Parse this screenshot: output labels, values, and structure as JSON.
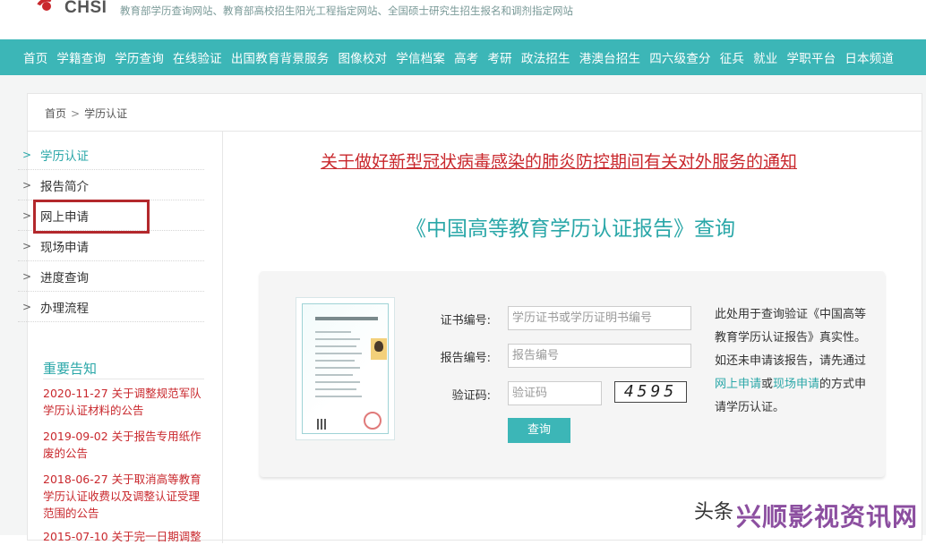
{
  "header": {
    "logo_text": "CHSI",
    "slogan": "教育部学历查询网站、教育部高校招生阳光工程指定网站、全国硕士研究生招生报名和调剂指定网站"
  },
  "nav": [
    "首页",
    "学籍查询",
    "学历查询",
    "在线验证",
    "出国教育背景服务",
    "图像校对",
    "学信档案",
    "高考",
    "考研",
    "政法招生",
    "港澳台招生",
    "四六级查分",
    "征兵",
    "就业",
    "学职平台",
    "日本频道"
  ],
  "breadcrumb": {
    "home": "首页",
    "sep": ">",
    "current": "学历认证"
  },
  "sidebar": {
    "items": [
      {
        "label": "学历认证",
        "chevron": ">"
      },
      {
        "label": "报告简介",
        "chevron": ">"
      },
      {
        "label": "网上申请",
        "chevron": ">"
      },
      {
        "label": "现场申请",
        "chevron": ">"
      },
      {
        "label": "进度查询",
        "chevron": ">"
      },
      {
        "label": "办理流程",
        "chevron": ">"
      }
    ],
    "notices_title": "重要告知",
    "notices": [
      "2020-11-27 关于调整规范军队学历认证材料的公告",
      "2019-09-02 关于报告专用纸作废的公告",
      "2018-06-27 关于取消高等教育学历认证收费以及调整认证受理范围的公告",
      "2015-07-10 关于完一日期调整"
    ]
  },
  "main": {
    "alert": "关于做好新型冠状病毒感染的肺炎防控期间有关对外服务的通知",
    "title": "《中国高等教育学历认证报告》查询",
    "form": {
      "cert_label": "证书编号:",
      "cert_placeholder": "学历证书或学历证明书编号",
      "report_label": "报告编号:",
      "report_placeholder": "报告编号",
      "captcha_label": "验证码:",
      "captcha_placeholder": "验证码",
      "captcha_text": "4595",
      "submit": "查询"
    },
    "desc": {
      "p1": "此处用于查询验证《中国高等教育学历认证报告》真实性。如还未申请该报告，请先通过",
      "link1": "网上申请",
      "or": "或",
      "link2": "现场申请",
      "p2": "的方式申请学历认证。"
    }
  },
  "watermark": {
    "brand": "头条",
    "text": "兴顺影视资讯网"
  },
  "colors": {
    "accent": "#3cb6b7",
    "link": "#2aa7a8",
    "alert": "#c9282d",
    "highlight_box": "#b3282c"
  }
}
